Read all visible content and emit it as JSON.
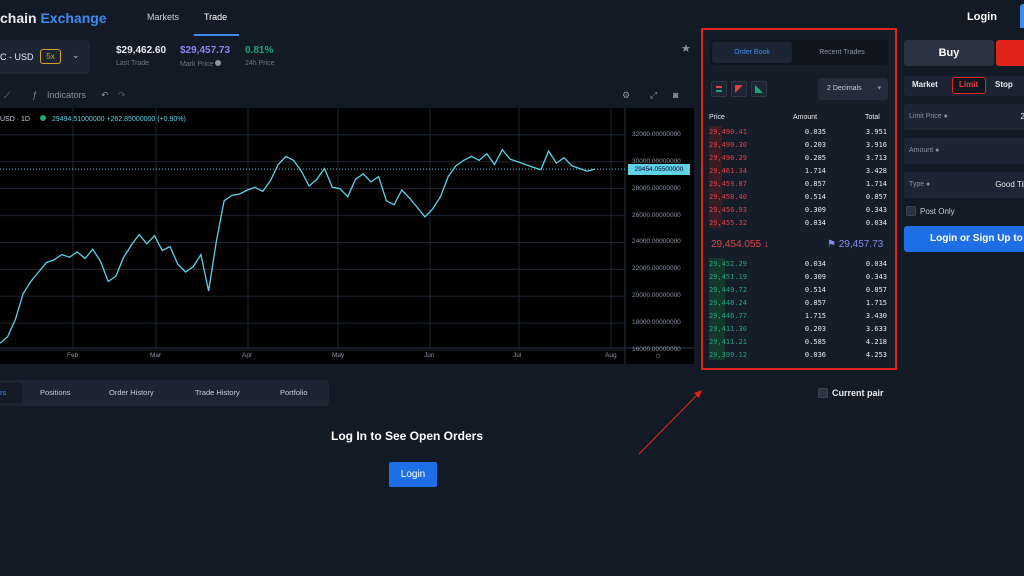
{
  "header": {
    "logo_prefix": "chain",
    "logo_blue": "Exchange",
    "nav": [
      "Markets",
      "Trade"
    ],
    "login": "Login"
  },
  "ticker": {
    "pair": "C - USD",
    "leverage": "5x",
    "last_trade": "$29,462.60",
    "last_trade_label": "Last Trade",
    "mark_price": "$29,457.73",
    "mark_price_label": "Mark Price",
    "change": "0.81%",
    "change_label": "24h Price"
  },
  "chart_toolbar": {
    "indicators": "Indicators"
  },
  "chart": {
    "legend_symbol": "USD · 1D",
    "legend_values": "29494.51000000 +262.85000000 (+0.90%)",
    "last_price_tag": "29454.05500000",
    "y_ticks": [
      "32000.00000000",
      "30000.00000000",
      "28000.00000000",
      "26000.00000000",
      "24000.00000000",
      "22000.00000000",
      "20000.00000000",
      "18000.00000000",
      "16000.00000000"
    ],
    "x_ticks": [
      "Feb",
      "Mar",
      "Apr",
      "May",
      "Jun",
      "Jul",
      "Aug"
    ]
  },
  "chart_data": {
    "type": "line",
    "ylim": [
      14960,
      34000
    ],
    "grid": true,
    "series": [
      {
        "values": [
          16500,
          17000,
          18300,
          20200,
          21100,
          21800,
          22500,
          22700,
          23100,
          22900,
          23300,
          22800,
          23500,
          22600,
          21100,
          21500,
          22900,
          23800,
          24600,
          23900,
          24500,
          23400,
          23700,
          22400,
          21800,
          22200,
          23100,
          20400,
          24100,
          27100,
          27500,
          27600,
          27900,
          28100,
          27800,
          28600,
          29800,
          30400,
          30100,
          29300,
          28200,
          28700,
          29500,
          28100,
          28000,
          27400,
          28700,
          29100,
          28500,
          28900,
          27100,
          26800,
          27900,
          27300,
          26600,
          25900,
          26500,
          27400,
          28900,
          29700,
          30100,
          30400,
          30100,
          30600,
          29800,
          30900,
          30200,
          30000,
          29800,
          29600,
          29400,
          30800,
          29900,
          30300,
          29700,
          29500,
          29300,
          29454
        ]
      }
    ]
  },
  "orderbook": {
    "tabs": [
      "Order Book",
      "Recent Trades"
    ],
    "decimals": "2 Decimals",
    "headers": [
      "Price",
      "Amount",
      "Total"
    ],
    "asks": [
      [
        "29,490.41",
        "0.035",
        "3.951"
      ],
      [
        "29,490.30",
        "0.203",
        "3.916"
      ],
      [
        "29,490.29",
        "0.285",
        "3.713"
      ],
      [
        "29,461.34",
        "1.714",
        "3.428"
      ],
      [
        "29,459.87",
        "0.857",
        "1.714"
      ],
      [
        "29,458.40",
        "0.514",
        "0.857"
      ],
      [
        "29,456.93",
        "0.309",
        "0.343"
      ],
      [
        "29,455.32",
        "0.034",
        "0.034"
      ]
    ],
    "mid_price": "29,454.055",
    "mark_price": "29,457.73",
    "bids": [
      [
        "29,452.29",
        "0.034",
        "0.034"
      ],
      [
        "29,451.19",
        "0.309",
        "0.343"
      ],
      [
        "29,449.72",
        "0.514",
        "0.857"
      ],
      [
        "29,448.24",
        "0.857",
        "1.715"
      ],
      [
        "29,446.77",
        "1.715",
        "3.430"
      ],
      [
        "29,411.30",
        "0.203",
        "3.633"
      ],
      [
        "29,411.21",
        "0.585",
        "4.218"
      ],
      [
        "29,399.12",
        "0.036",
        "4.253"
      ]
    ]
  },
  "order_form": {
    "buy": "Buy",
    "types": [
      "Market",
      "Limit",
      "Stop"
    ],
    "limit_price_label": "Limit Price",
    "limit_price_value": "2",
    "amount_label": "Amount",
    "type_label": "Type",
    "type_value": "Good Til",
    "post_only": "Post Only",
    "login_signup": "Login or Sign Up to"
  },
  "bottom": {
    "tabs": [
      "rs",
      "Positions",
      "Order History",
      "Trade History",
      "Portfolio"
    ],
    "current_pair": "Current pair",
    "login_message": "Log In to See Open Orders",
    "login_button": "Login"
  },
  "colors": {
    "accent": "#3d8cf0",
    "sell": "#e0241a",
    "ask": "#e0404a",
    "bid": "#1fa67a",
    "line": "#61d1e8",
    "highlight_box": "#e0241a"
  }
}
